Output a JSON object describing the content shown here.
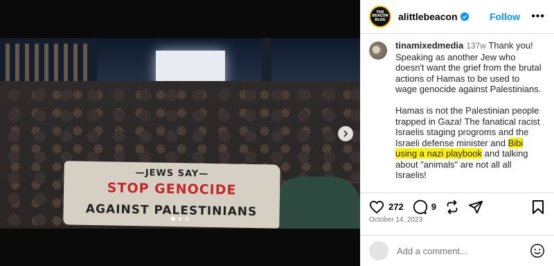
{
  "post": {
    "banner_lines": [
      "—JEWS SAY—",
      "STOP GENOCIDE",
      "AGAINST PALESTINIANS"
    ],
    "carousel_total": 3,
    "carousel_active": 1
  },
  "header": {
    "avatar_text": [
      "THE",
      "BEACON",
      "BLOG"
    ],
    "username": "alittlebeacon",
    "follow_label": "Follow",
    "more_label": "•••"
  },
  "comment": {
    "username": "tinamixedmedia",
    "time": "137w",
    "para1": "Thank you! Speaking as another Jew who doesn't want the grief from the brutal actions of Hamas to be used to wage genocide against Palestinians.",
    "para2_before": "Hamas is not the Palestinian people trapped in Gaza! The fanatical racist Israelis staging progroms and the Israeli defense minister and ",
    "para2_highlight": "Bibi using a nazi playbook",
    "para2_after": " and talking about \"animals\" are not all all Israelis!"
  },
  "actions": {
    "likes": "272",
    "comments": "9",
    "date": "October 14, 2023"
  },
  "add_comment": {
    "placeholder": "Add a comment..."
  },
  "colors": {
    "accent": "#0095f6",
    "highlight": "#fff200"
  }
}
